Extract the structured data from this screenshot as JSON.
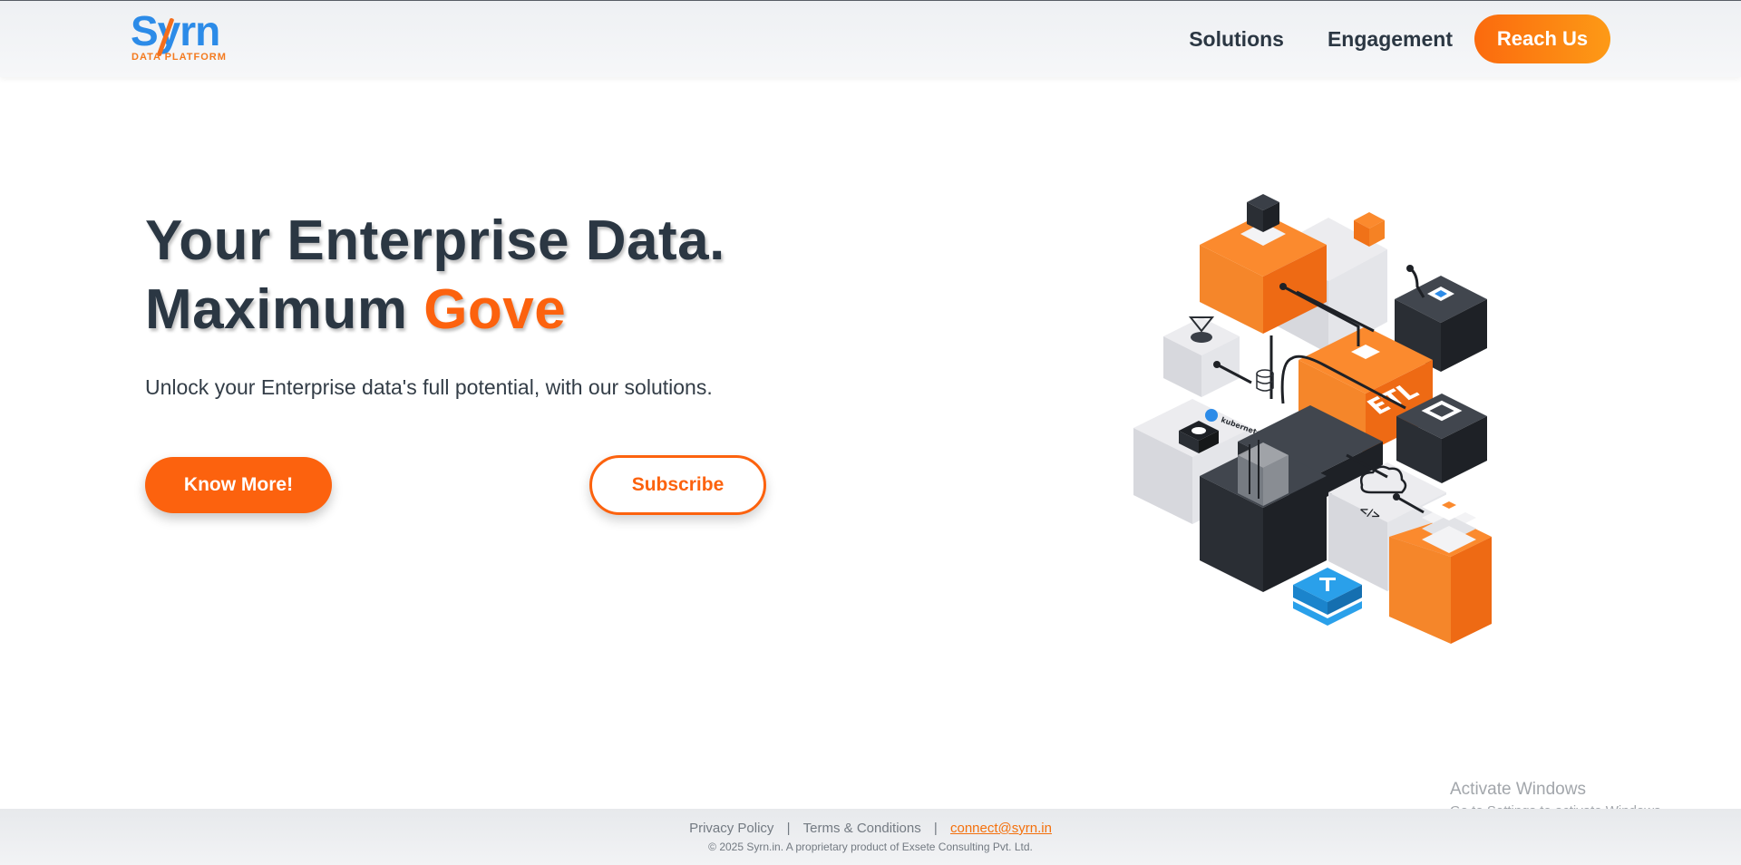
{
  "header": {
    "logo_text": "Syrn",
    "logo_subtitle": "DATA PLATFORM",
    "nav": [
      "Solutions",
      "Engagement"
    ],
    "cta_label": "Reach Us"
  },
  "hero": {
    "title_line1": "Your Enterprise Data.",
    "title_line2_prefix": "Maximum ",
    "title_line2_accent": "Gove",
    "subtitle": "Unlock your Enterprise data's full potential, with our solutions.",
    "primary_button": "Know More!",
    "secondary_button": "Subscribe"
  },
  "illustration": {
    "etl_label": "ETL",
    "kubernetes_label": "kubernetes",
    "code_label": "</>"
  },
  "watermark": {
    "title": "Activate Windows",
    "subtitle": "Go to Settings to activate Windows."
  },
  "footer": {
    "privacy": "Privacy Policy",
    "terms": "Terms & Conditions",
    "separator": "|",
    "email": "connect@syrn.in",
    "copyright": "© 2025 Syrn.in. A proprietary product of Exsete Consulting Pvt. Ltd."
  },
  "colors": {
    "accent": "#fc620e",
    "brand_blue": "#2c8be8",
    "text_dark": "#2b3743"
  }
}
